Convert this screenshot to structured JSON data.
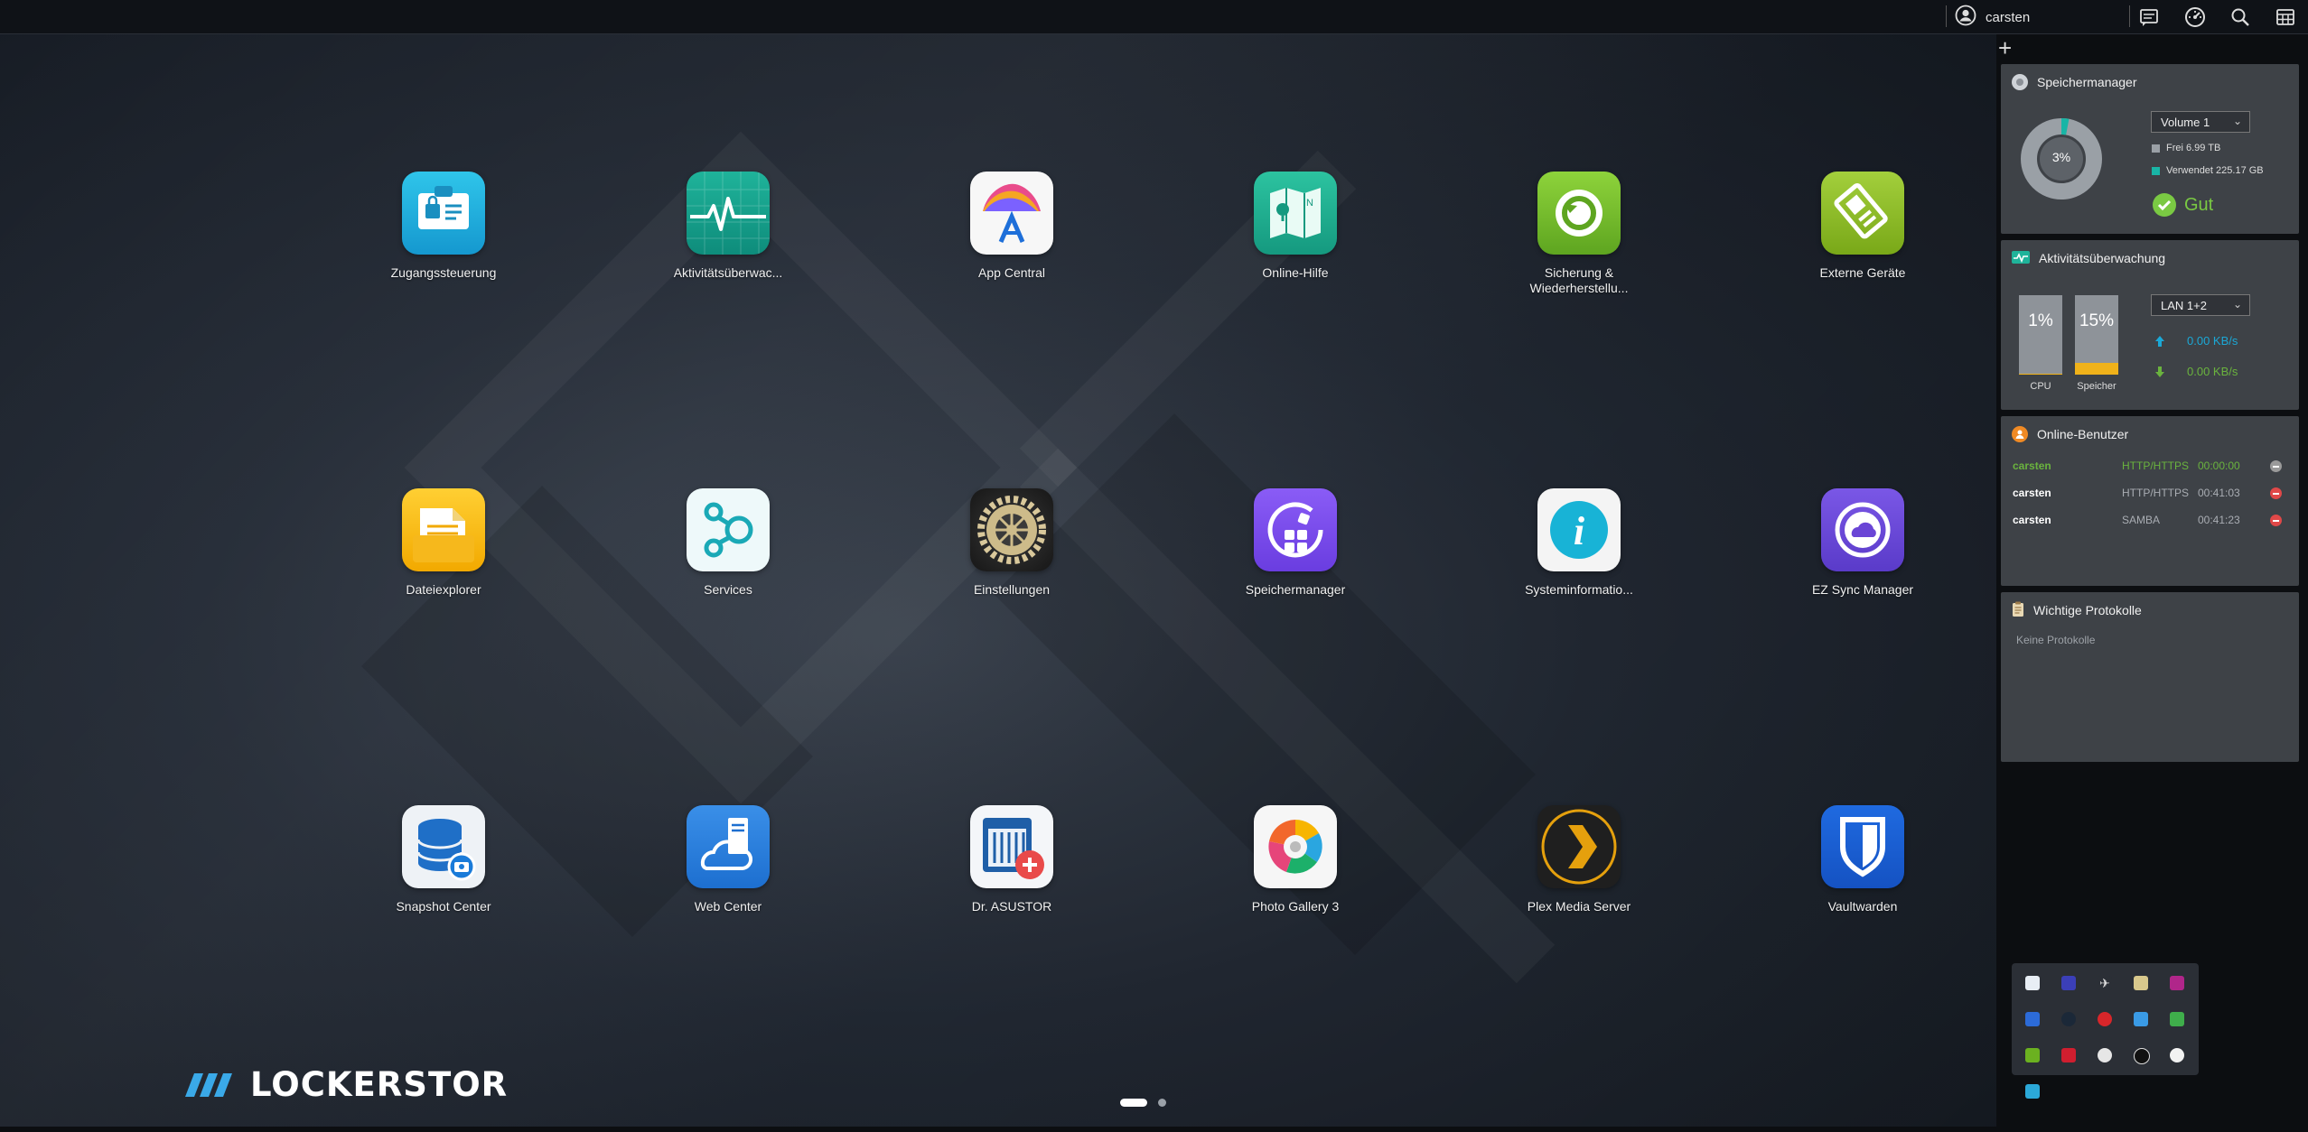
{
  "topbar": {
    "username": "carsten",
    "icons": [
      "user-circle-icon",
      "message-icon",
      "dashboard-gauge-icon",
      "search-icon",
      "widgets-grid-icon"
    ]
  },
  "apps": [
    {
      "label": "Zugangssteuerung",
      "icon": "access-control-icon"
    },
    {
      "label": "Aktivitätsüberwac...",
      "icon": "activity-monitor-icon"
    },
    {
      "label": "App Central",
      "icon": "app-central-icon"
    },
    {
      "label": "Online-Hilfe",
      "icon": "online-help-map-icon"
    },
    {
      "label": "Sicherung &",
      "label2": "Wiederherstellu...",
      "icon": "backup-restore-icon"
    },
    {
      "label": "Externe Geräte",
      "icon": "external-devices-icon"
    },
    {
      "label": "Dateiexplorer",
      "icon": "file-explorer-icon"
    },
    {
      "label": "Services",
      "icon": "services-icon"
    },
    {
      "label": "Einstellungen",
      "icon": "settings-gear-icon"
    },
    {
      "label": "Speichermanager",
      "icon": "storage-manager-icon"
    },
    {
      "label": "Systeminformatio...",
      "icon": "system-information-icon"
    },
    {
      "label": "EZ Sync Manager",
      "icon": "ez-sync-icon"
    },
    {
      "label": "Snapshot Center",
      "icon": "snapshot-center-icon"
    },
    {
      "label": "Web Center",
      "icon": "web-center-icon"
    },
    {
      "label": "Dr. ASUSTOR",
      "icon": "dr-asustor-icon"
    },
    {
      "label": "Photo Gallery 3",
      "icon": "photo-gallery-icon"
    },
    {
      "label": "Plex Media Server",
      "icon": "plex-icon"
    },
    {
      "label": "Vaultwarden",
      "icon": "vaultwarden-shield-icon"
    }
  ],
  "branding": {
    "logo_text": "LOCKERSTOR"
  },
  "pager": {
    "pages": 2,
    "current": 1
  },
  "widgets": {
    "storage": {
      "title": "Speichermanager",
      "donut_label": "3%",
      "used_fraction": 0.03,
      "volume_select": "Volume 1",
      "free": "Frei 6.99 TB",
      "used": "Verwendet 225.17 GB",
      "status": "Gut",
      "colors": {
        "used": "#19b5a6",
        "free": "#9aa0a6",
        "status": "#7ac943"
      }
    },
    "activity": {
      "title": "Aktivitätsüberwachung",
      "cpu_value": "1%",
      "cpu_label": "CPU",
      "cpu_fraction": 0.01,
      "mem_value": "15%",
      "mem_label": "Speicher",
      "mem_fraction": 0.15,
      "lan_select": "LAN 1+2",
      "upload": "0.00 KB/s",
      "download": "0.00 KB/s",
      "colors": {
        "upload": "#1ba8d6",
        "download": "#6ab33e",
        "mem_fill": "#f0b21a"
      }
    },
    "online_users": {
      "title": "Online-Benutzer",
      "rows": [
        {
          "user": "carsten",
          "protocol": "HTTP/HTTPS",
          "time": "00:00:00",
          "current": true
        },
        {
          "user": "carsten",
          "protocol": "HTTP/HTTPS",
          "time": "00:41:03",
          "current": false
        },
        {
          "user": "carsten",
          "protocol": "SAMBA",
          "time": "00:41:23",
          "current": false
        }
      ]
    },
    "logs": {
      "title": "Wichtige Protokolle",
      "empty": "Keine Protokolle"
    }
  },
  "tray": {
    "icons": [
      "nas-sync-icon",
      "monitor-icon",
      "airplane-icon",
      "display-icon",
      "purple-app-icon",
      "malwarebytes-icon",
      "steam-icon",
      "red-app-icon",
      "onedrive-icon",
      "green-arrow-icon",
      "nvidia-icon",
      "amd-icon",
      "circle-app-icon",
      "logitech-icon",
      "xbox-icon",
      "security-shield-icon"
    ]
  }
}
